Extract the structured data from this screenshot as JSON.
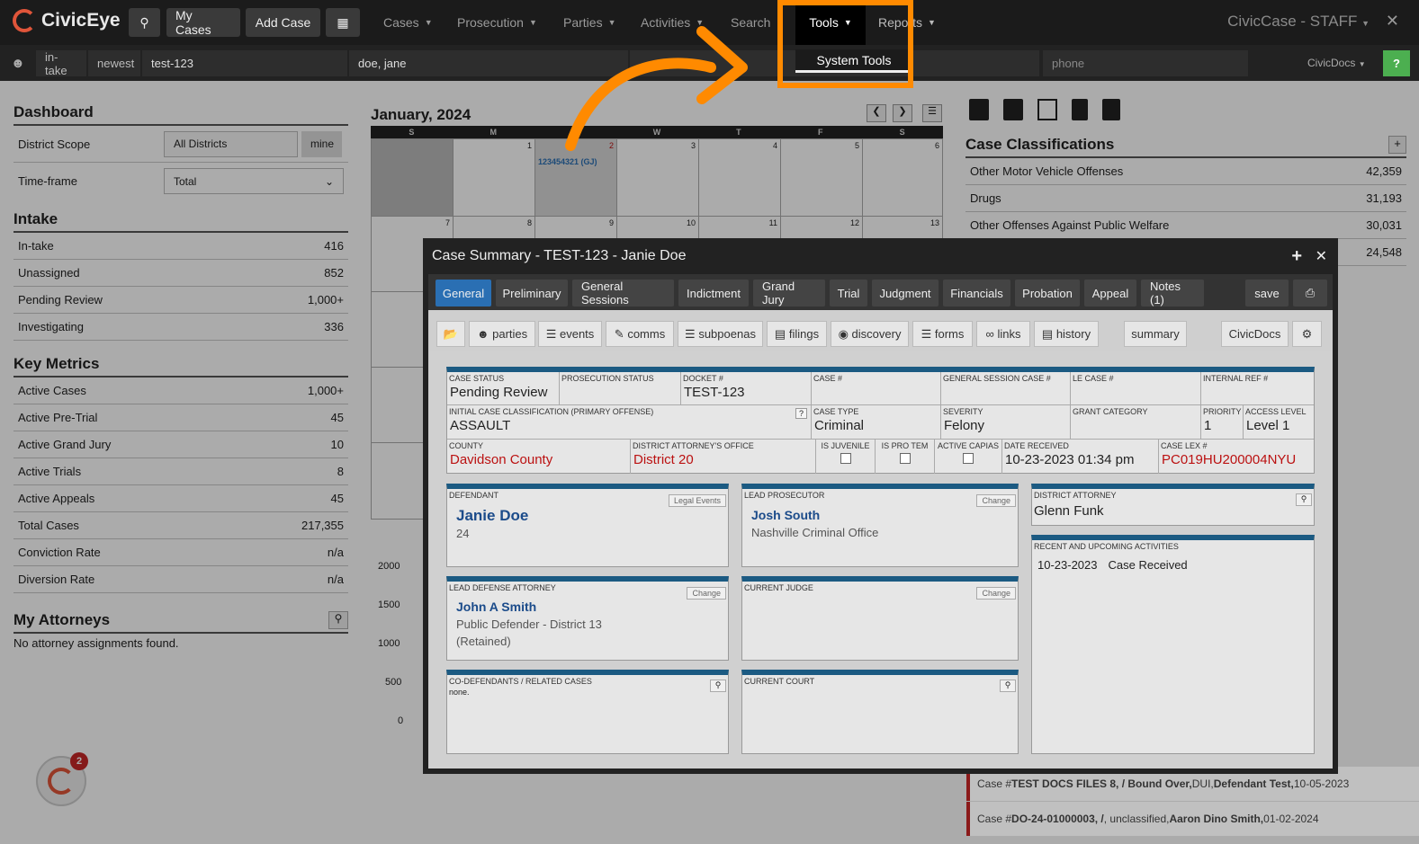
{
  "app": {
    "brand": "CivicEye",
    "window_title": "CivicCase - STAFF"
  },
  "topbar": {
    "my_cases": "My Cases",
    "add_case": "Add Case",
    "nav": [
      "Cases",
      "Prosecution",
      "Parties",
      "Activities",
      "Search",
      "Tools",
      "Reports"
    ]
  },
  "subbar": {
    "intake": "in-take",
    "newest": "newest",
    "case_field": "test-123",
    "name_field": "doe, jane",
    "phone_field": "phone",
    "civicdocs": "CivicDocs",
    "help": "?"
  },
  "tools_dropdown": {
    "item": "System Tools"
  },
  "dashboard": {
    "title": "Dashboard",
    "district_scope_label": "District Scope",
    "district_scope_value": "All Districts",
    "mine": "mine",
    "timeframe_label": "Time-frame",
    "timeframe_value": "Total",
    "intake_title": "Intake",
    "intake": [
      {
        "label": "In-take",
        "value": "416"
      },
      {
        "label": "Unassigned",
        "value": "852"
      },
      {
        "label": "Pending Review",
        "value": "1,000+"
      },
      {
        "label": "Investigating",
        "value": "336"
      }
    ],
    "metrics_title": "Key Metrics",
    "metrics": [
      {
        "label": "Active Cases",
        "value": "1,000+"
      },
      {
        "label": "Active Pre-Trial",
        "value": "45"
      },
      {
        "label": "Active Grand Jury",
        "value": "10"
      },
      {
        "label": "Active Trials",
        "value": "8"
      },
      {
        "label": "Active Appeals",
        "value": "45"
      },
      {
        "label": "Total Cases",
        "value": "217,355"
      },
      {
        "label": "Conviction Rate",
        "value": "n/a"
      },
      {
        "label": "Diversion Rate",
        "value": "n/a"
      }
    ],
    "attorneys_title": "My Attorneys",
    "attorneys_empty": "No attorney assignments found."
  },
  "calendar": {
    "month": "January, 2024",
    "days": [
      "S",
      "M",
      "T",
      "W",
      "T",
      "F",
      "S"
    ],
    "week1": [
      "",
      "1",
      "2",
      "3",
      "4",
      "5",
      "6"
    ],
    "week2": [
      "7",
      "8",
      "9",
      "10",
      "11",
      "12",
      "13"
    ],
    "event": "123454321 (GJ)"
  },
  "chart_axis": [
    "2000",
    "1500",
    "1000",
    "500",
    "0"
  ],
  "classifications": {
    "title": "Case Classifications",
    "rows": [
      {
        "label": "Other Motor Vehicle Offenses",
        "value": "42,359"
      },
      {
        "label": "Drugs",
        "value": "31,193"
      },
      {
        "label": "Other Offenses Against Public Welfare",
        "value": "30,031"
      },
      {
        "label": "",
        "value": "24,548"
      }
    ]
  },
  "feed": [
    {
      "prefix": "Case #",
      "id": "TEST DOCS FILES 8, / Bound Over,",
      "type": " DUI, ",
      "name": "Defendant Test,",
      "date": " 10-05-2023"
    },
    {
      "prefix": "Case #",
      "id": "DO-24-01000003, /",
      "type": " , unclassified, ",
      "name": "Aaron Dino Smith,",
      "date": " 01-02-2024"
    }
  ],
  "modal": {
    "title": "Case Summary - TEST-123 - Janie Doe",
    "tabs": [
      "General",
      "Preliminary",
      "General Sessions",
      "Indictment",
      "Grand Jury",
      "Trial",
      "Judgment",
      "Financials",
      "Probation",
      "Appeal",
      "Notes (1)",
      "save"
    ],
    "tools": [
      "parties",
      "events",
      "comms",
      "subpoenas",
      "filings",
      "discovery",
      "forms",
      "links",
      "history",
      "summary",
      "CivicDocs"
    ],
    "fields": {
      "case_status_l": "Case Status",
      "case_status": "Pending Review",
      "pros_status_l": "Prosecution Status",
      "docket_l": "Docket #",
      "docket": "TEST-123",
      "case_no_l": "Case #",
      "gs_case_l": "General Session Case #",
      "le_case_l": "LE Case #",
      "int_ref_l": "Internal Ref #",
      "init_class_l": "Initial Case Classification (Primary Offense)",
      "init_class": "ASSAULT",
      "case_type_l": "Case Type",
      "case_type": "Criminal",
      "severity_l": "Severity",
      "severity": "Felony",
      "grant_l": "Grant Category",
      "priority_l": "Priority",
      "priority": "1",
      "access_l": "Access Level",
      "access": "Level 1",
      "county_l": "County",
      "county": "Davidson County",
      "da_office_l": "District Attorney's Office",
      "da_office": "District 20",
      "juvenile_l": "Is Juvenile",
      "protem_l": "Is Pro Tem",
      "capias_l": "Active Capias",
      "received_l": "Date Received",
      "received": "10-23-2023 01:34 pm",
      "lex_l": "Case Lex #",
      "lex": "PC019HU200004NYU"
    },
    "defendant": {
      "label": "Defendant",
      "action": "Legal Events",
      "name": "Janie Doe",
      "age": "24"
    },
    "lead_prosecutor": {
      "label": "Lead Prosecutor",
      "action": "Change",
      "name": "Josh South",
      "office": "Nashville Criminal Office"
    },
    "district_attorney": {
      "label": "District Attorney",
      "name": "Glenn Funk"
    },
    "activities": {
      "label": "Recent and Upcoming Activities",
      "date": "10-23-2023",
      "desc": "Case Received"
    },
    "defense": {
      "label": "Lead Defense Attorney",
      "action": "Change",
      "name": "John A Smith",
      "office": "Public Defender - District 13",
      "status": "(Retained)"
    },
    "judge": {
      "label": "Current Judge",
      "action": "Change"
    },
    "codef": {
      "label": "Co-Defendants / Related Cases",
      "value": "none."
    },
    "court": {
      "label": "Current Court"
    }
  },
  "notification_count": "2",
  "colors": {
    "accent": "#2a6fb3",
    "highlight": "#ff8a00",
    "panel_bar": "#1b5a82"
  }
}
